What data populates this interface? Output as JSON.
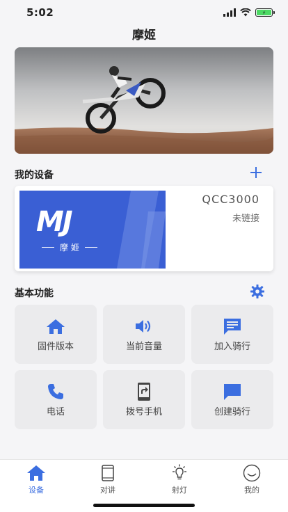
{
  "status_bar": {
    "time": "5:02"
  },
  "header": {
    "title": "摩姬"
  },
  "my_devices": {
    "title": "我的设备",
    "device": {
      "name": "QCC3000",
      "status": "未链接",
      "logo_text": "MJ",
      "logo_subtitle": "摩 姬"
    }
  },
  "features": {
    "title": "基本功能",
    "items": [
      {
        "label": "固件版本",
        "icon": "home-icon"
      },
      {
        "label": "当前音量",
        "icon": "volume-icon"
      },
      {
        "label": "加入骑行",
        "icon": "message-icon"
      },
      {
        "label": "电话",
        "icon": "phone-icon"
      },
      {
        "label": "拨号手机",
        "icon": "phone-forward-icon"
      },
      {
        "label": "创建骑行",
        "icon": "chat-icon"
      }
    ]
  },
  "tabbar": {
    "tabs": [
      {
        "label": "设备",
        "icon": "home-icon",
        "active": true
      },
      {
        "label": "对讲",
        "icon": "tablet-icon",
        "active": false
      },
      {
        "label": "射灯",
        "icon": "bulb-icon",
        "active": false
      },
      {
        "label": "我的",
        "icon": "smile-icon",
        "active": false
      }
    ]
  },
  "colors": {
    "accent": "#3b6ee0",
    "logo_bg": "#3a5fd4",
    "tile_bg": "#ebebed"
  }
}
